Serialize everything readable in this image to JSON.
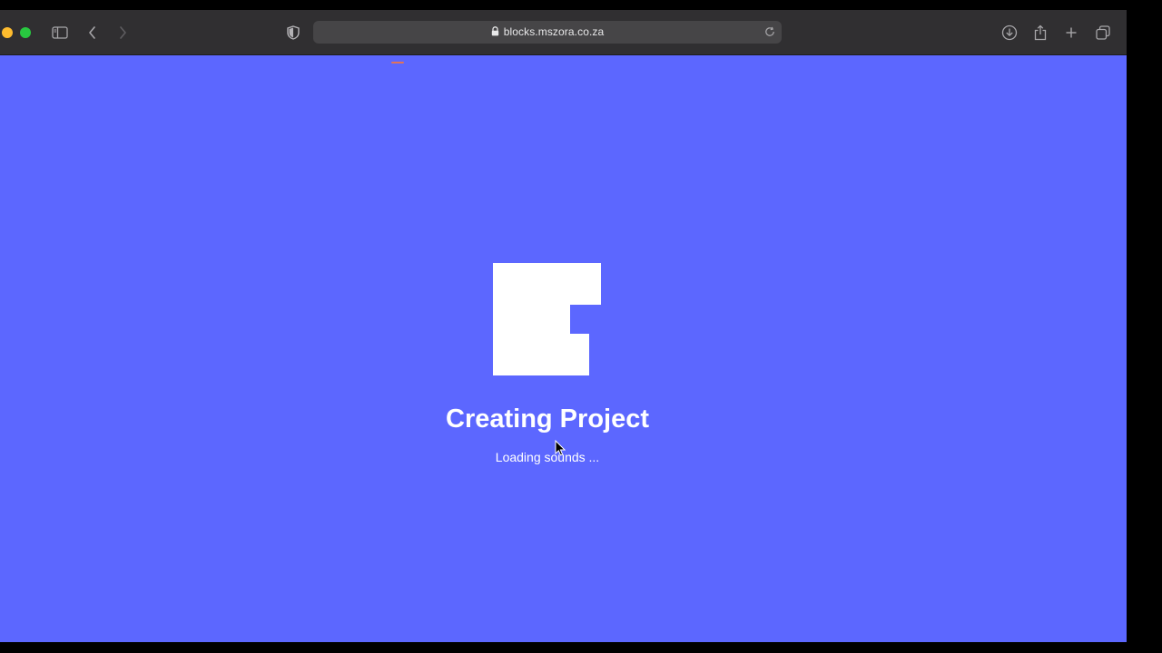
{
  "browser": {
    "address_bar": {
      "url": "blocks.mszora.co.za"
    },
    "icons": {
      "sidebar": "sidebar-icon",
      "back": "chevron-left-icon",
      "forward": "chevron-right-icon",
      "privacy": "shield-icon",
      "lock": "lock-icon",
      "reload": "reload-icon",
      "downloads": "download-icon",
      "share": "share-icon",
      "new_tab": "plus-icon",
      "tab_overview": "tabs-icon"
    }
  },
  "loading_screen": {
    "title": "Creating Project",
    "status": "Loading sounds ...",
    "background_color": "#5c67ff"
  }
}
